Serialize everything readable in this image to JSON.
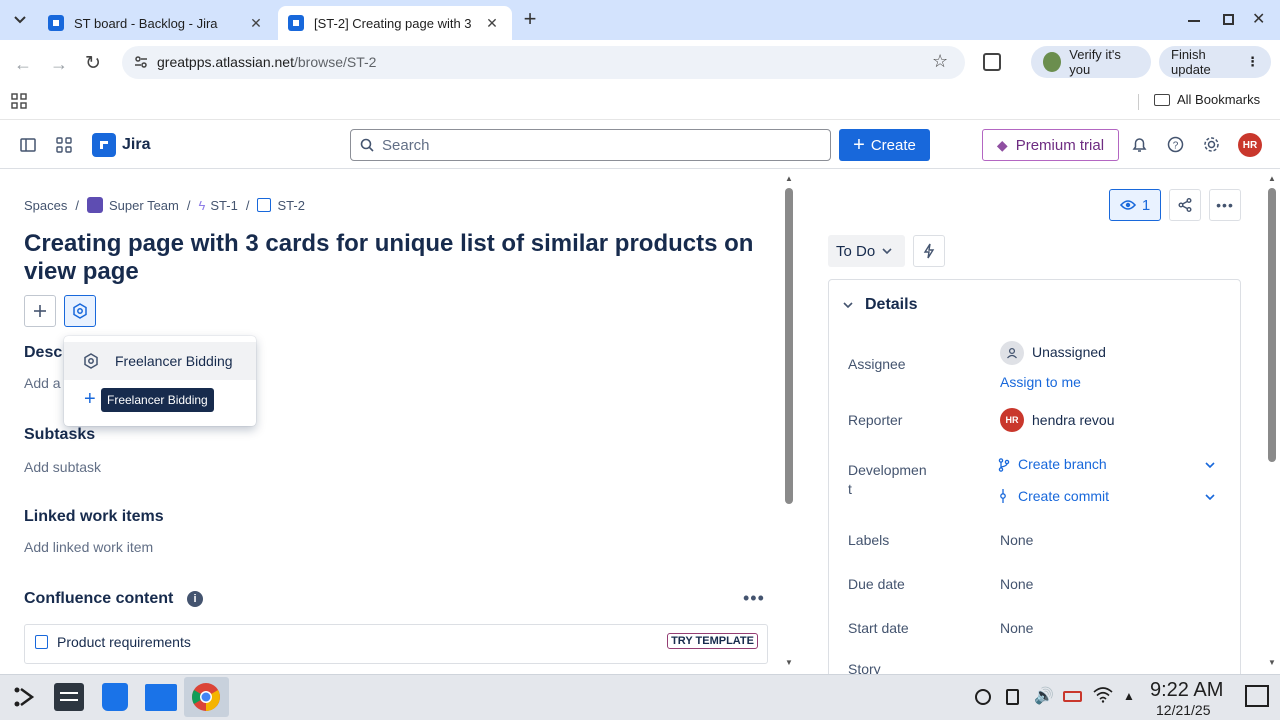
{
  "browser": {
    "tabs": [
      {
        "title": "ST board - Backlog - Jira",
        "active": false
      },
      {
        "title": "[ST-2] Creating page with 3",
        "active": true
      }
    ],
    "url_host": "greatpps.atlassian.net",
    "url_path": "/browse/ST-2",
    "verify_label": "Verify it's you",
    "finish_update_label": "Finish update",
    "all_bookmarks_label": "All Bookmarks"
  },
  "jira_nav": {
    "app_name": "Jira",
    "search_placeholder": "Search",
    "create_label": "Create",
    "premium_label": "Premium trial",
    "avatar_initials": "HR",
    "brand_color": "#1868db"
  },
  "breadcrumb": {
    "spaces": "Spaces",
    "team": "Super Team",
    "parent": "ST-1",
    "issue": "ST-2"
  },
  "issue": {
    "title": "Creating page with 3 cards for unique list of similar products on view page"
  },
  "sections": {
    "description_label": "Desc",
    "description_placeholder": "Add a",
    "subtasks_label": "Subtasks",
    "subtasks_placeholder": "Add subtask",
    "linked_label": "Linked work items",
    "linked_placeholder": "Add linked work item",
    "confluence_label": "Confluence content",
    "confluence_item": "Product requirements",
    "try_template": "TRY TEMPLATE"
  },
  "dropdown": {
    "item_label": "Freelancer Bidding",
    "tooltip": "Freelancer Bidding"
  },
  "right_panel": {
    "watch_count": "1",
    "status": "To Do",
    "details_label": "Details",
    "fields": {
      "assignee_label": "Assignee",
      "assignee_value": "Unassigned",
      "assign_to_me": "Assign to me",
      "reporter_label": "Reporter",
      "reporter_initials": "HR",
      "reporter_value": "hendra revou",
      "development_label_1": "Developmen",
      "development_label_2": "t",
      "create_branch": "Create branch",
      "create_commit": "Create commit",
      "labels_label": "Labels",
      "labels_value": "None",
      "due_label": "Due date",
      "due_value": "None",
      "start_label": "Start date",
      "start_value": "None",
      "story_label": "Story"
    }
  },
  "taskbar": {
    "time": "9:22 AM",
    "date": "12/21/25"
  }
}
